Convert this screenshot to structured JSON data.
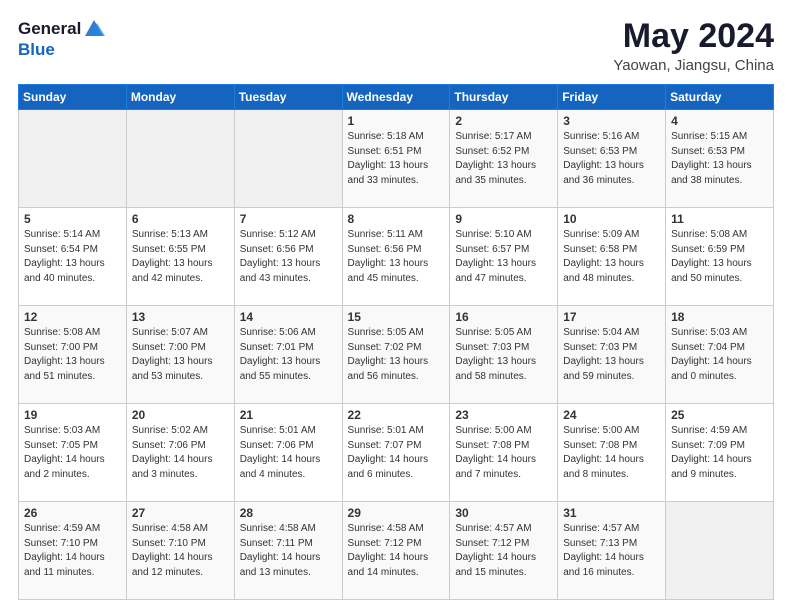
{
  "header": {
    "logo_line1": "General",
    "logo_line2": "Blue",
    "title": "May 2024",
    "subtitle": "Yaowan, Jiangsu, China"
  },
  "days_of_week": [
    "Sunday",
    "Monday",
    "Tuesday",
    "Wednesday",
    "Thursday",
    "Friday",
    "Saturday"
  ],
  "weeks": [
    [
      {
        "day": "",
        "content": ""
      },
      {
        "day": "",
        "content": ""
      },
      {
        "day": "",
        "content": ""
      },
      {
        "day": "1",
        "content": "Sunrise: 5:18 AM\nSunset: 6:51 PM\nDaylight: 13 hours\nand 33 minutes."
      },
      {
        "day": "2",
        "content": "Sunrise: 5:17 AM\nSunset: 6:52 PM\nDaylight: 13 hours\nand 35 minutes."
      },
      {
        "day": "3",
        "content": "Sunrise: 5:16 AM\nSunset: 6:53 PM\nDaylight: 13 hours\nand 36 minutes."
      },
      {
        "day": "4",
        "content": "Sunrise: 5:15 AM\nSunset: 6:53 PM\nDaylight: 13 hours\nand 38 minutes."
      }
    ],
    [
      {
        "day": "5",
        "content": "Sunrise: 5:14 AM\nSunset: 6:54 PM\nDaylight: 13 hours\nand 40 minutes."
      },
      {
        "day": "6",
        "content": "Sunrise: 5:13 AM\nSunset: 6:55 PM\nDaylight: 13 hours\nand 42 minutes."
      },
      {
        "day": "7",
        "content": "Sunrise: 5:12 AM\nSunset: 6:56 PM\nDaylight: 13 hours\nand 43 minutes."
      },
      {
        "day": "8",
        "content": "Sunrise: 5:11 AM\nSunset: 6:56 PM\nDaylight: 13 hours\nand 45 minutes."
      },
      {
        "day": "9",
        "content": "Sunrise: 5:10 AM\nSunset: 6:57 PM\nDaylight: 13 hours\nand 47 minutes."
      },
      {
        "day": "10",
        "content": "Sunrise: 5:09 AM\nSunset: 6:58 PM\nDaylight: 13 hours\nand 48 minutes."
      },
      {
        "day": "11",
        "content": "Sunrise: 5:08 AM\nSunset: 6:59 PM\nDaylight: 13 hours\nand 50 minutes."
      }
    ],
    [
      {
        "day": "12",
        "content": "Sunrise: 5:08 AM\nSunset: 7:00 PM\nDaylight: 13 hours\nand 51 minutes."
      },
      {
        "day": "13",
        "content": "Sunrise: 5:07 AM\nSunset: 7:00 PM\nDaylight: 13 hours\nand 53 minutes."
      },
      {
        "day": "14",
        "content": "Sunrise: 5:06 AM\nSunset: 7:01 PM\nDaylight: 13 hours\nand 55 minutes."
      },
      {
        "day": "15",
        "content": "Sunrise: 5:05 AM\nSunset: 7:02 PM\nDaylight: 13 hours\nand 56 minutes."
      },
      {
        "day": "16",
        "content": "Sunrise: 5:05 AM\nSunset: 7:03 PM\nDaylight: 13 hours\nand 58 minutes."
      },
      {
        "day": "17",
        "content": "Sunrise: 5:04 AM\nSunset: 7:03 PM\nDaylight: 13 hours\nand 59 minutes."
      },
      {
        "day": "18",
        "content": "Sunrise: 5:03 AM\nSunset: 7:04 PM\nDaylight: 14 hours\nand 0 minutes."
      }
    ],
    [
      {
        "day": "19",
        "content": "Sunrise: 5:03 AM\nSunset: 7:05 PM\nDaylight: 14 hours\nand 2 minutes."
      },
      {
        "day": "20",
        "content": "Sunrise: 5:02 AM\nSunset: 7:06 PM\nDaylight: 14 hours\nand 3 minutes."
      },
      {
        "day": "21",
        "content": "Sunrise: 5:01 AM\nSunset: 7:06 PM\nDaylight: 14 hours\nand 4 minutes."
      },
      {
        "day": "22",
        "content": "Sunrise: 5:01 AM\nSunset: 7:07 PM\nDaylight: 14 hours\nand 6 minutes."
      },
      {
        "day": "23",
        "content": "Sunrise: 5:00 AM\nSunset: 7:08 PM\nDaylight: 14 hours\nand 7 minutes."
      },
      {
        "day": "24",
        "content": "Sunrise: 5:00 AM\nSunset: 7:08 PM\nDaylight: 14 hours\nand 8 minutes."
      },
      {
        "day": "25",
        "content": "Sunrise: 4:59 AM\nSunset: 7:09 PM\nDaylight: 14 hours\nand 9 minutes."
      }
    ],
    [
      {
        "day": "26",
        "content": "Sunrise: 4:59 AM\nSunset: 7:10 PM\nDaylight: 14 hours\nand 11 minutes."
      },
      {
        "day": "27",
        "content": "Sunrise: 4:58 AM\nSunset: 7:10 PM\nDaylight: 14 hours\nand 12 minutes."
      },
      {
        "day": "28",
        "content": "Sunrise: 4:58 AM\nSunset: 7:11 PM\nDaylight: 14 hours\nand 13 minutes."
      },
      {
        "day": "29",
        "content": "Sunrise: 4:58 AM\nSunset: 7:12 PM\nDaylight: 14 hours\nand 14 minutes."
      },
      {
        "day": "30",
        "content": "Sunrise: 4:57 AM\nSunset: 7:12 PM\nDaylight: 14 hours\nand 15 minutes."
      },
      {
        "day": "31",
        "content": "Sunrise: 4:57 AM\nSunset: 7:13 PM\nDaylight: 14 hours\nand 16 minutes."
      },
      {
        "day": "",
        "content": ""
      }
    ]
  ]
}
